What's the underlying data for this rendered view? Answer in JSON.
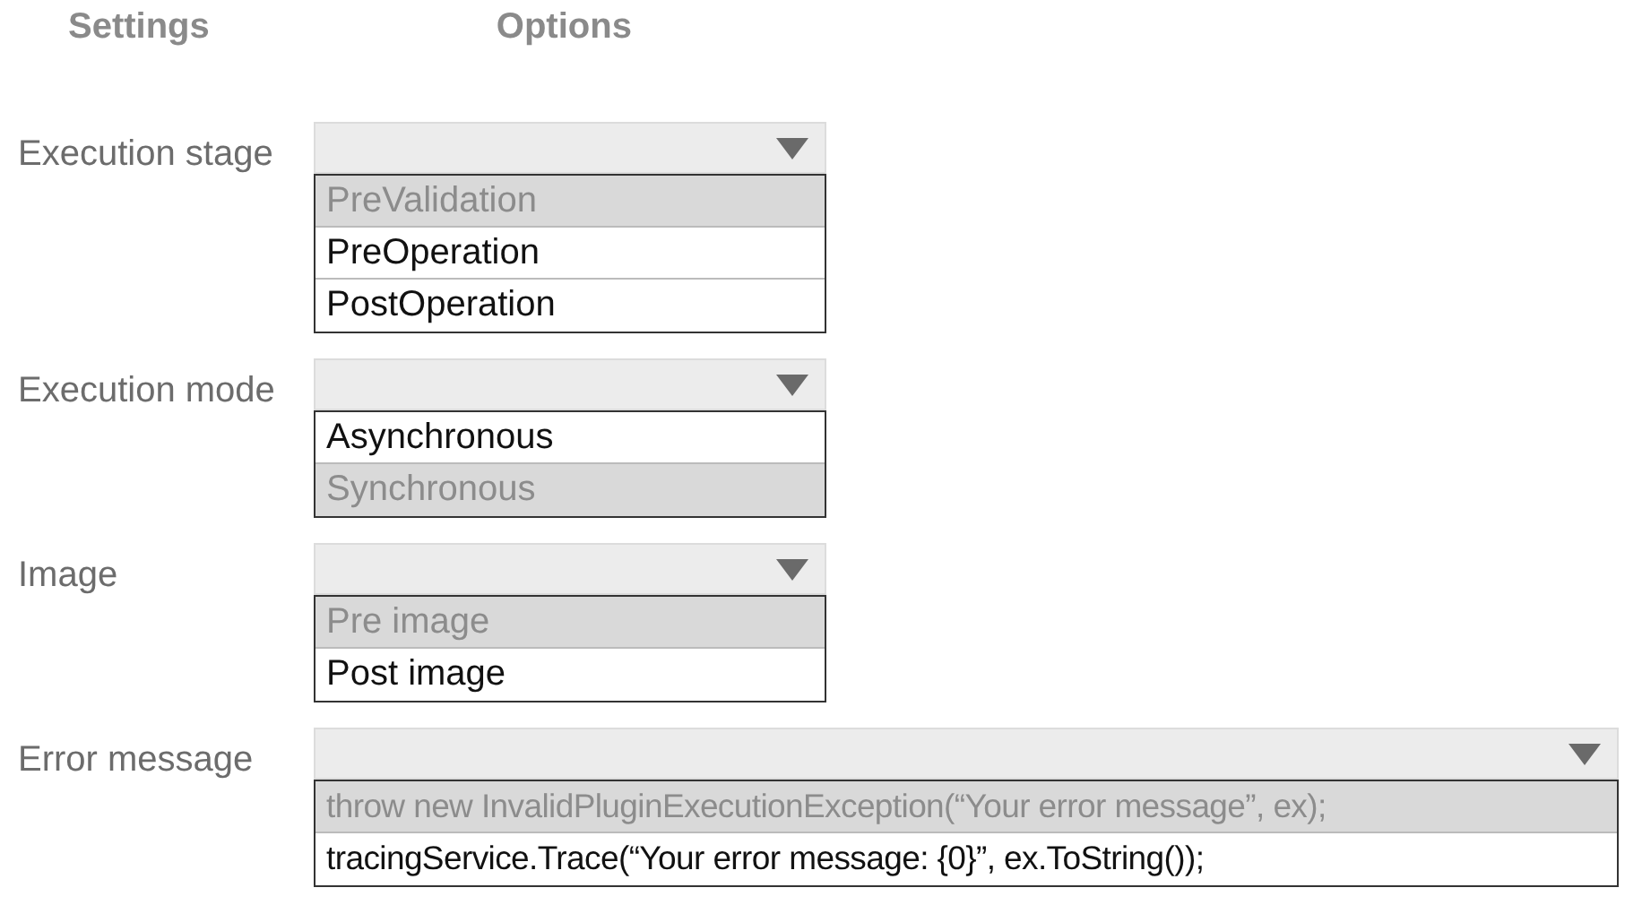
{
  "columns": [
    "Settings",
    "Options"
  ],
  "settings": [
    {
      "label": "Execution stage",
      "wide": false,
      "options": [
        {
          "text": "PreValidation",
          "selected": true
        },
        {
          "text": "PreOperation",
          "selected": false
        },
        {
          "text": "PostOperation",
          "selected": false
        }
      ]
    },
    {
      "label": "Execution mode",
      "wide": false,
      "options": [
        {
          "text": "Asynchronous",
          "selected": false
        },
        {
          "text": "Synchronous",
          "selected": true
        }
      ]
    },
    {
      "label": "Image",
      "wide": false,
      "options": [
        {
          "text": "Pre image",
          "selected": true
        },
        {
          "text": "Post image",
          "selected": false
        }
      ]
    },
    {
      "label": "Error message",
      "wide": true,
      "options": [
        {
          "text": "throw new InvalidPluginExecutionException(“Your error message”, ex);",
          "selected": true
        },
        {
          "text": "tracingService.Trace(“Your error message: {0}”, ex.ToString());",
          "selected": false
        }
      ]
    }
  ]
}
